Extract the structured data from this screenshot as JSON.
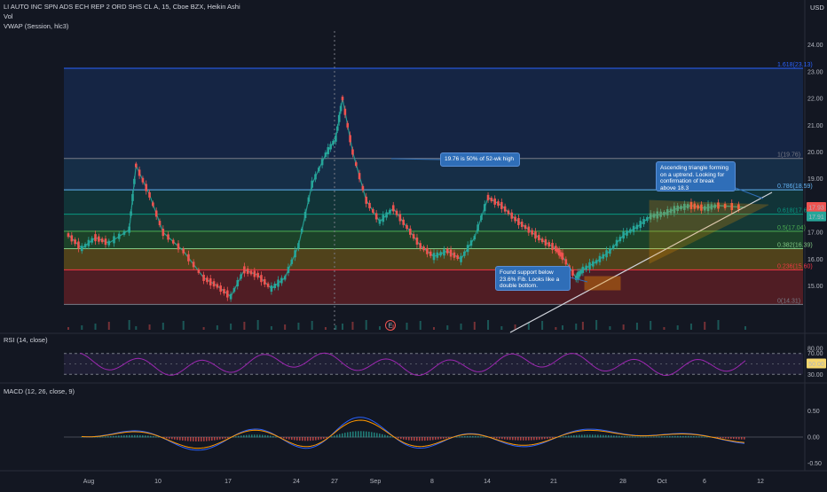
{
  "header": {
    "title": "LI AUTO INC SPN ADS ECH REP 2 ORD SHS CL A, 15, Cboe BZX, Heikin Ashi",
    "vol_label": "Vol",
    "vwap_label": "VWAP (Session, hlc3)",
    "currency": "USD"
  },
  "indicator_labels": {
    "rsi": "RSI (14, close)",
    "macd": "MACD (12, 26, close, 9)"
  },
  "colors": {
    "background": "#131722",
    "up": "#26a69a",
    "down": "#ef5350",
    "rsi_line": "#9c27b0",
    "macd_line": "#2962ff",
    "signal_line": "#ff9800",
    "vwap": "#ff9800",
    "trendline": "#d1d4dc",
    "price_badge": "#ef5350",
    "vwap_badge": "#26a69a",
    "rsi_badge": "#f5d76e"
  },
  "annotations": {
    "fifty_pct_note": "19.76 is 50% of 52-wk high",
    "triangle_note": "Ascending triangle forming on a uptrend. Looking for confirmation of break above 18.3",
    "support_note": "Found support below 23.6% Fib. Looks like a double bottom.",
    "earnings_marker": "E"
  },
  "price_badges": {
    "last": "17.93",
    "vwap": "17.91",
    "rsi": "50.00"
  },
  "chart_data": [
    {
      "type": "candlestick",
      "title": "LI AUTO INC SPN ADS ECH REP 2 ORD SHS CL A, 15, Cboe BZX, Heikin Ashi",
      "xlabel": "",
      "ylabel": "USD",
      "x_ticks": [
        "Aug",
        "10",
        "17",
        "24",
        "27",
        "Sep",
        "8",
        "14",
        "21",
        "28",
        "Oct",
        "6",
        "12"
      ],
      "y_ticks": [
        15.0,
        16.0,
        17.0,
        18.0,
        19.0,
        20.0,
        21.0,
        22.0,
        23.0,
        24.0
      ],
      "ylim": [
        14.0,
        24.8
      ],
      "last_price": 17.93,
      "vwap_last": 17.91,
      "close_path": [
        {
          "x": 0.0,
          "y": 16.9
        },
        {
          "x": 0.02,
          "y": 16.4
        },
        {
          "x": 0.04,
          "y": 16.8
        },
        {
          "x": 0.06,
          "y": 16.6
        },
        {
          "x": 0.09,
          "y": 17.1
        },
        {
          "x": 0.1,
          "y": 19.5
        },
        {
          "x": 0.12,
          "y": 18.4
        },
        {
          "x": 0.14,
          "y": 17.0
        },
        {
          "x": 0.17,
          "y": 16.3
        },
        {
          "x": 0.2,
          "y": 15.3
        },
        {
          "x": 0.22,
          "y": 15.0
        },
        {
          "x": 0.24,
          "y": 14.6
        },
        {
          "x": 0.26,
          "y": 15.6
        },
        {
          "x": 0.28,
          "y": 15.4
        },
        {
          "x": 0.3,
          "y": 14.9
        },
        {
          "x": 0.32,
          "y": 15.3
        },
        {
          "x": 0.34,
          "y": 16.5
        },
        {
          "x": 0.36,
          "y": 18.8
        },
        {
          "x": 0.38,
          "y": 19.9
        },
        {
          "x": 0.395,
          "y": 20.5
        },
        {
          "x": 0.405,
          "y": 22.0
        },
        {
          "x": 0.42,
          "y": 20.0
        },
        {
          "x": 0.44,
          "y": 18.2
        },
        {
          "x": 0.46,
          "y": 17.4
        },
        {
          "x": 0.48,
          "y": 17.9
        },
        {
          "x": 0.5,
          "y": 17.2
        },
        {
          "x": 0.52,
          "y": 16.5
        },
        {
          "x": 0.54,
          "y": 16.1
        },
        {
          "x": 0.56,
          "y": 16.3
        },
        {
          "x": 0.58,
          "y": 16.0
        },
        {
          "x": 0.6,
          "y": 16.8
        },
        {
          "x": 0.62,
          "y": 18.3
        },
        {
          "x": 0.64,
          "y": 18.0
        },
        {
          "x": 0.66,
          "y": 17.5
        },
        {
          "x": 0.68,
          "y": 17.1
        },
        {
          "x": 0.7,
          "y": 16.7
        },
        {
          "x": 0.72,
          "y": 16.4
        },
        {
          "x": 0.73,
          "y": 16.1
        },
        {
          "x": 0.75,
          "y": 15.3
        },
        {
          "x": 0.76,
          "y": 15.6
        },
        {
          "x": 0.78,
          "y": 15.9
        },
        {
          "x": 0.8,
          "y": 16.3
        },
        {
          "x": 0.82,
          "y": 16.9
        },
        {
          "x": 0.84,
          "y": 17.2
        },
        {
          "x": 0.86,
          "y": 17.6
        },
        {
          "x": 0.88,
          "y": 17.7
        },
        {
          "x": 0.9,
          "y": 17.9
        },
        {
          "x": 0.92,
          "y": 18.0
        },
        {
          "x": 0.94,
          "y": 17.9
        },
        {
          "x": 0.96,
          "y": 18.0
        },
        {
          "x": 1.0,
          "y": 17.93
        }
      ],
      "fib_levels": [
        {
          "label": "0(14.31)",
          "value": 14.31,
          "color": "#787b86"
        },
        {
          "label": "0.236(15.60)",
          "value": 15.6,
          "color": "#f23645"
        },
        {
          "label": "0.382(16.39)",
          "value": 16.39,
          "color": "#81c784"
        },
        {
          "label": "0.5(17.04)",
          "value": 17.04,
          "color": "#4caf50"
        },
        {
          "label": "0.618(17.68)",
          "value": 17.68,
          "color": "#089981"
        },
        {
          "label": "0.786(18.59)",
          "value": 18.59,
          "color": "#64b5f6"
        },
        {
          "label": "1(19.76)",
          "value": 19.76,
          "color": "#787b86"
        },
        {
          "label": "1.618(23.13)",
          "value": 23.13,
          "color": "#2962ff"
        }
      ]
    },
    {
      "type": "line",
      "title": "RSI (14, close)",
      "y_ticks": [
        30.0,
        50.0,
        70.0,
        80.0
      ],
      "ylim": [
        25,
        90
      ],
      "last_value": 50.0
    },
    {
      "type": "line",
      "title": "MACD (12, 26, close, 9)",
      "y_ticks": [
        -0.5,
        0.0,
        0.5
      ],
      "ylim": [
        -0.6,
        0.8
      ]
    }
  ]
}
